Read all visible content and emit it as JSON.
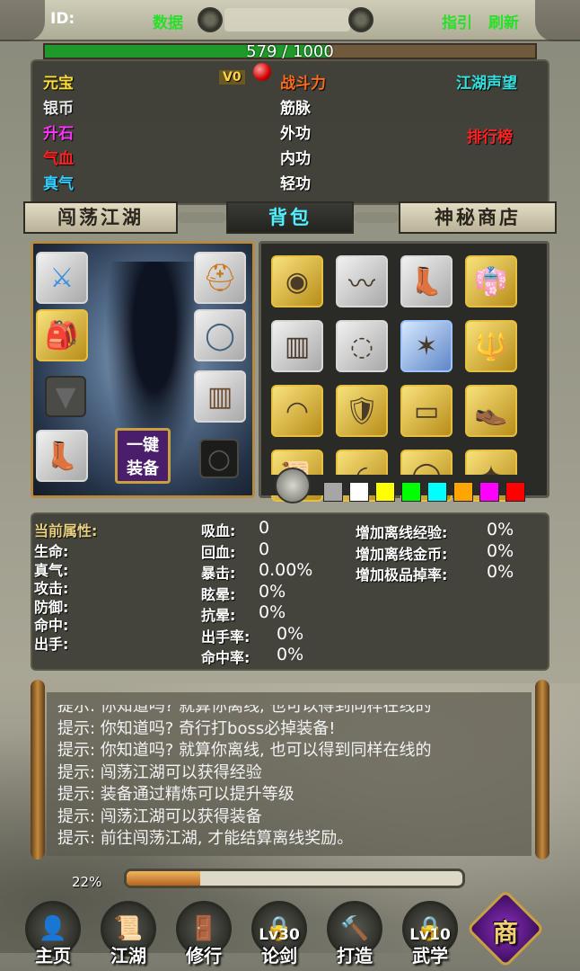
{
  "topbar": {
    "id_label": "ID:",
    "data_label": "数据",
    "guide_label": "指引",
    "refresh_label": "刷新"
  },
  "exp": {
    "current": 579,
    "max": 1000,
    "text": "579 / 1000"
  },
  "stats": {
    "yuanbao": "元宝",
    "vip": "V0",
    "silver": "银币",
    "shengshi": "升石",
    "qixue": "气血",
    "zhenqi": "真气",
    "power": "战斗力",
    "jinmai": "筋脉",
    "waigong": "外功",
    "neigong": "内功",
    "qinggong": "轻功",
    "reputation": "江湖声望",
    "ranking": "排行榜"
  },
  "tabs": [
    "闯荡江湖",
    "背包",
    "神秘商店"
  ],
  "equipment": {
    "one_key_line1": "一键",
    "one_key_line2": "装备",
    "slots": [
      "sword-icon",
      "helmet-icon",
      "backpack-icon",
      "necklace-icon",
      "armor-empty-icon",
      "bracer-icon",
      "boots-icon",
      "ring-empty-icon"
    ]
  },
  "bag": {
    "items": [
      "headband-icon",
      "sash-icon",
      "boots-icon",
      "robe-icon",
      "bracer-icon",
      "beads-icon",
      "amulet-icon",
      "staff-icon",
      "cloth-icon",
      "armor-icon",
      "belt-icon",
      "shoes-icon",
      "scroll-icon",
      "bow-icon",
      "ring-icon",
      "weapon-icon"
    ],
    "filter_colors": [
      "#a6a6a6",
      "#ffffff",
      "#ffff00",
      "#00ff00",
      "#00ffff",
      "#ffa500",
      "#ff00ff",
      "#ff0000"
    ]
  },
  "attributes": {
    "header": "当前属性:",
    "left": [
      "生命:",
      "真气:",
      "攻击:",
      "防御:",
      "命中:",
      "出手:"
    ],
    "mid_labels": [
      "吸血:",
      "回血:",
      "暴击:",
      "眩晕:",
      "抗晕:",
      "出手率:",
      "命中率:"
    ],
    "mid_values": [
      "0",
      "0",
      "0.00%",
      "0%",
      "0%",
      "0%",
      "0%"
    ],
    "right_labels": [
      "增加离线经验:",
      "增加离线金币:",
      "增加极品掉率:"
    ],
    "right_values": [
      "0%",
      "0%",
      "0%"
    ]
  },
  "messages": [
    "提示: 你知道吗? 就算你离线, 也可以得到同样在线的",
    "提示: 你知道吗? 奇行打boss必掉装备!",
    "提示: 你知道吗? 就算你离线, 也可以得到同样在线的",
    "提示: 闯荡江湖可以获得经验",
    "提示: 装备通过精炼可以提升等级",
    "提示: 闯荡江湖可以获得装备",
    "提示: 前往闯荡江湖, 才能结算离线奖励。"
  ],
  "progress": {
    "percent": 22,
    "text": "22%"
  },
  "nav": [
    {
      "label": "主页",
      "icon": "avatar-icon",
      "lock": ""
    },
    {
      "label": "江湖",
      "icon": "scroll-icon",
      "lock": ""
    },
    {
      "label": "修行",
      "icon": "door-icon",
      "lock": ""
    },
    {
      "label": "论剑",
      "icon": "lock-icon",
      "lock": "Lv30"
    },
    {
      "label": "打造",
      "icon": "hammer-icon",
      "lock": ""
    },
    {
      "label": "武学",
      "icon": "lock-icon",
      "lock": "Lv10"
    },
    {
      "label": "商",
      "icon": "shop-icon",
      "lock": ""
    }
  ]
}
